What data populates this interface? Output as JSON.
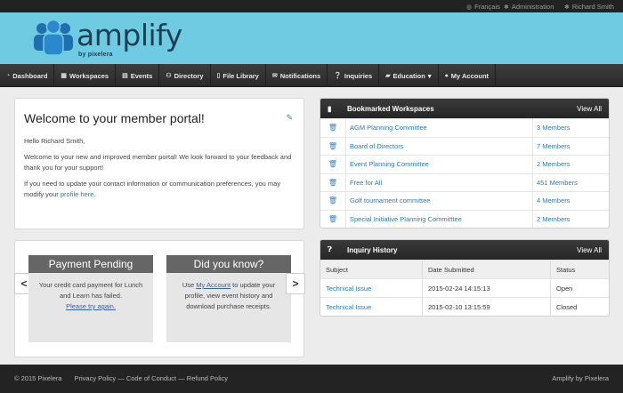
{
  "topbar": {
    "language": "Français",
    "admin": "Administration",
    "user": "Richard Smith"
  },
  "logo": {
    "word": "amplify",
    "sub": "by pixelera"
  },
  "nav": [
    {
      "label": "Dashboard",
      "icon": "dashboard-icon"
    },
    {
      "label": "Workspaces",
      "icon": "grid-icon"
    },
    {
      "label": "Events",
      "icon": "calendar-icon"
    },
    {
      "label": "Directory",
      "icon": "users-icon"
    },
    {
      "label": "File Library",
      "icon": "file-icon"
    },
    {
      "label": "Notifications",
      "icon": "envelope-icon"
    },
    {
      "label": "Inquiries",
      "icon": "question-icon"
    },
    {
      "label": "Education",
      "icon": "book-icon",
      "caret": "▾"
    },
    {
      "label": "My Account",
      "icon": "user-icon"
    }
  ],
  "welcome": {
    "title": "Welcome to your member portal!",
    "greeting": "Hello Richard Smith,",
    "p1": "Welcome to your new and improved member portal! We look forward to your feedback and thank you for your support!",
    "p2_before": "If you need to update your contact information or communication preferences, you may modify your ",
    "p2_link": "profile here",
    "p2_after": "."
  },
  "carousel": {
    "prev": "<",
    "next": ">",
    "slide1": {
      "title": "Payment Pending",
      "body": "Your credit card payment for Lunch and Learn has failed.",
      "link": "Please try again."
    },
    "slide2": {
      "title": "Did you know?",
      "before": "Use ",
      "link": "My Account",
      "after": " to update your profile, view event history and download purchase receipts."
    }
  },
  "bookmarks": {
    "title": "Bookmarked Workspaces",
    "view_all": "View All",
    "rows": [
      {
        "name": "AGM Planning Committee",
        "members": "3 Members"
      },
      {
        "name": "Board of Directors",
        "members": "7 Members"
      },
      {
        "name": "Event Planning Committee",
        "members": "2 Members"
      },
      {
        "name": "Free for All",
        "members": "451 Members"
      },
      {
        "name": "Golf tournament committee",
        "members": "4 Members"
      },
      {
        "name": "Special Initiative Planning Committtee",
        "members": "2 Members"
      }
    ]
  },
  "inquiries": {
    "title": "Inquiry History",
    "view_all": "View All",
    "columns": [
      "Subject",
      "Date Submitted",
      "Status"
    ],
    "rows": [
      {
        "subject": "Technical Issue",
        "date": "2015-02-24 14:15:13",
        "status": "Open"
      },
      {
        "subject": "Technical Issue",
        "date": "2015-02-10 13:15:59",
        "status": "Closed"
      }
    ]
  },
  "footer": {
    "copyright": "© 2015 Pixelera",
    "links": "Privacy Policy — Code of Conduct — Refund Policy",
    "brand": "Amplify by Pixelera"
  },
  "colors": {
    "header_bg": "#6ecbe2",
    "nav_bg": "#2f2f2f",
    "link": "#2a7ab8",
    "footer_bg": "#232323"
  }
}
